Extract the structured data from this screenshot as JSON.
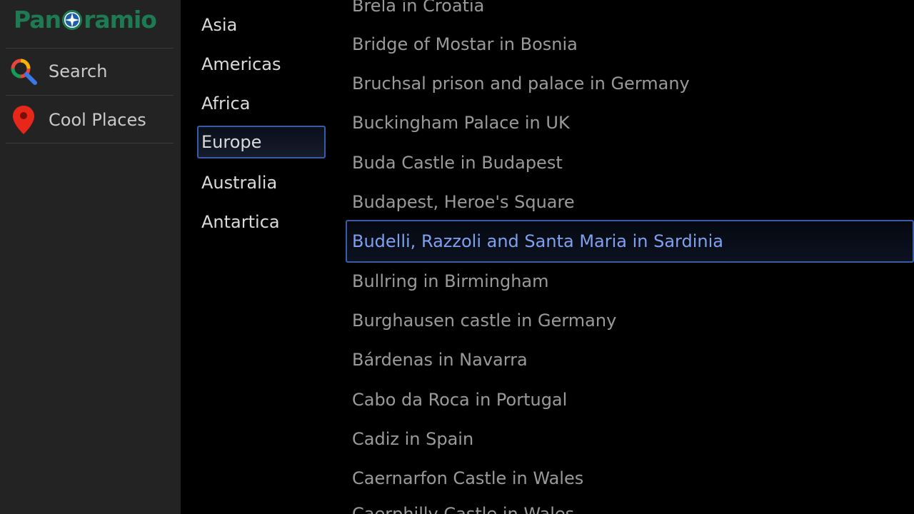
{
  "app": {
    "logo_text_left": "Pan",
    "logo_text_right": "ramio"
  },
  "sidebar": {
    "items": [
      {
        "label": "Search",
        "icon": "search-icon"
      },
      {
        "label": "Cool Places",
        "icon": "map-pin-icon"
      }
    ]
  },
  "regions": {
    "items": [
      "Asia",
      "Americas",
      "Africa",
      "Europe",
      "Australia",
      "Antartica"
    ],
    "selected": "Europe"
  },
  "places": {
    "items": [
      "Brela in Croatia",
      "Bridge of Mostar in Bosnia",
      "Bruchsal prison and palace in Germany",
      "Buckingham Palace in UK",
      "Buda Castle in Budapest",
      "Budapest, Heroe's Square",
      "Budelli, Razzoli and Santa Maria in Sardinia",
      "Bullring in Birmingham",
      "Burghausen castle in Germany",
      "Bárdenas in Navarra",
      "Cabo da Roca in Portugal",
      "Cadiz in Spain",
      "Caernarfon Castle in Wales",
      "Caerphilly Castle in Wales"
    ],
    "selected": "Budelli, Razzoli and Santa Maria in Sardinia"
  },
  "colors": {
    "sidebar_bg": "#232323",
    "logo_green": "#1e7a52",
    "focus_border": "#3a5ca8",
    "selected_text": "#7fa0ef"
  }
}
